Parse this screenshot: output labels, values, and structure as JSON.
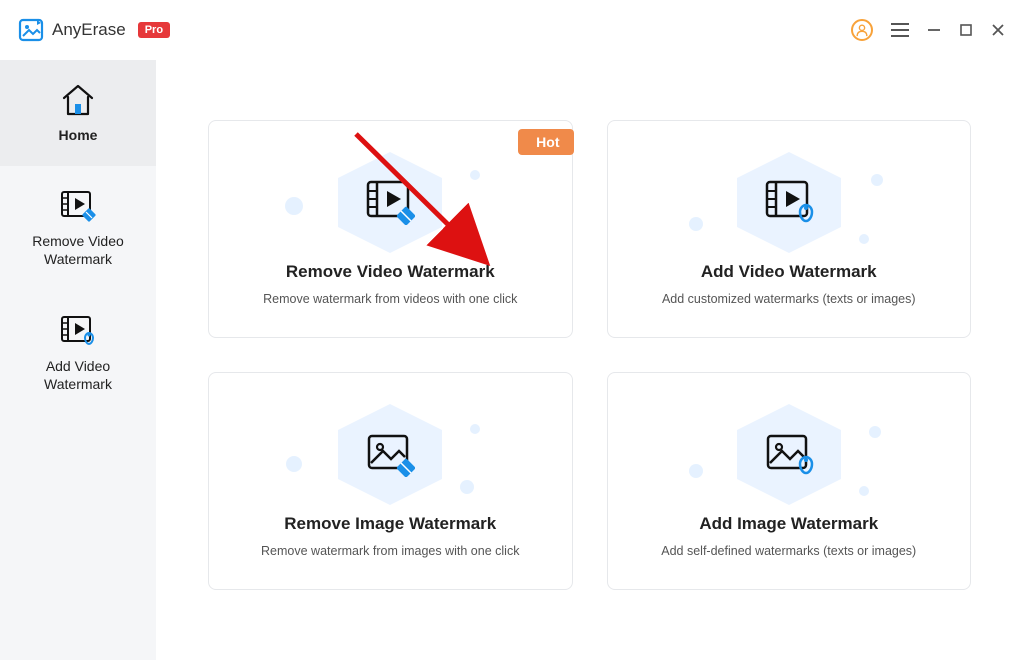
{
  "app": {
    "name": "AnyErase",
    "badge": "Pro"
  },
  "sidebar": {
    "items": [
      {
        "label": "Home"
      },
      {
        "label": "Remove Video Watermark"
      },
      {
        "label": "Add Video Watermark"
      }
    ]
  },
  "cards": [
    {
      "title": "Remove Video Watermark",
      "desc": "Remove watermark from videos with one click",
      "hot_label": "Hot"
    },
    {
      "title": "Add Video Watermark",
      "desc": "Add customized watermarks (texts or images)"
    },
    {
      "title": "Remove Image Watermark",
      "desc": "Remove watermark from images with one click"
    },
    {
      "title": "Add Image Watermark",
      "desc": "Add self-defined watermarks  (texts or images)"
    }
  ],
  "colors": {
    "accent_blue": "#1a8fe8",
    "hot_orange": "#f08a4a",
    "pro_red": "#e6383a",
    "avatar_ring": "#f8a23a"
  }
}
